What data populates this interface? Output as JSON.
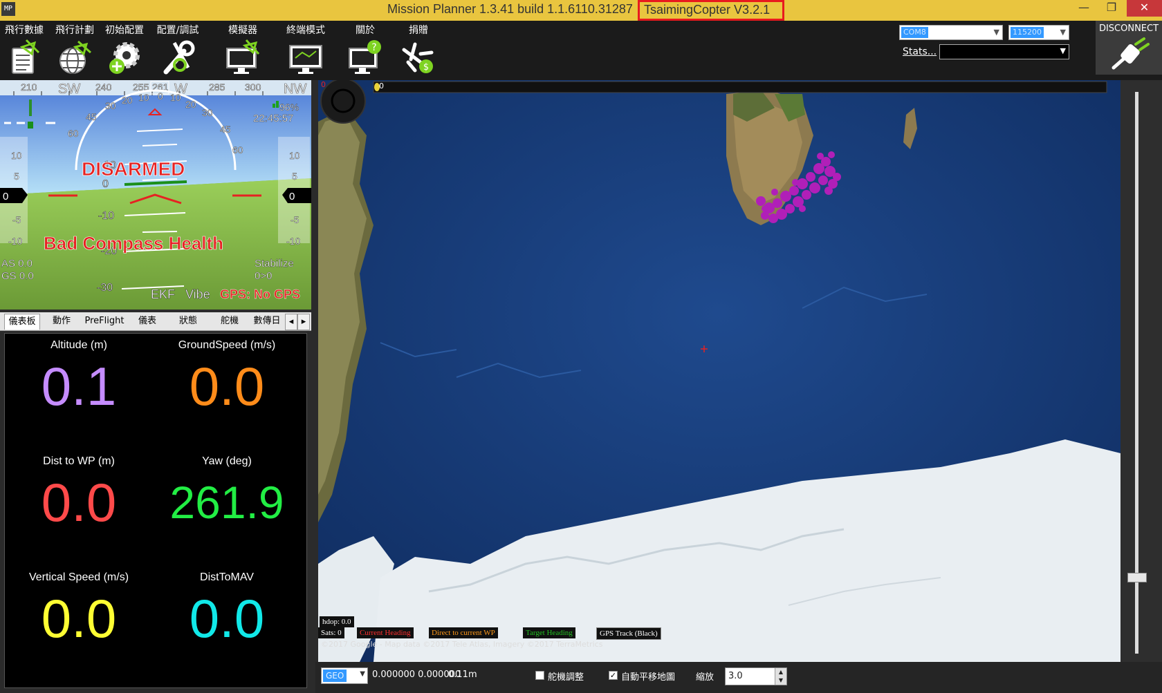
{
  "window": {
    "title_main": "Mission Planner 1.3.41 build 1.1.6110.31287",
    "title_firmware": "TsaimingCopter V3.2.1",
    "minimize": "—",
    "maximize": "❐",
    "close": "✕"
  },
  "menu": [
    {
      "label": "飛行數據",
      "icon": "flight-data-icon"
    },
    {
      "label": "飛行計劃",
      "icon": "flight-plan-icon"
    },
    {
      "label": "初始配置",
      "icon": "initial-setup-icon"
    },
    {
      "label": "配置/調試",
      "icon": "config-tuning-icon"
    },
    {
      "label": "模擬器",
      "icon": "simulation-icon"
    },
    {
      "label": "終端模式",
      "icon": "terminal-icon"
    },
    {
      "label": "關於",
      "icon": "help-icon"
    },
    {
      "label": "捐贈",
      "icon": "donate-icon"
    }
  ],
  "connection": {
    "port": "COM8",
    "baud": "115200",
    "stats_label": "Stats...",
    "connect_label": "DISCONNECT"
  },
  "hud": {
    "heading_ticks": [
      "210",
      "SW",
      "240",
      "255",
      "261",
      "W",
      "285",
      "300",
      "NW"
    ],
    "status": "DISARMED",
    "warning": "Bad Compass Health",
    "battery": "96%",
    "time": "22:45:57",
    "airspeed": "AS 0.0",
    "groundspeed": "GS 0.0",
    "mode": "Stabilize",
    "mode_sub": "0>0",
    "ekf": "EKF",
    "vibe": "Vibe",
    "gps": "GPS: No GPS",
    "pitch_labels": [
      "10",
      "0",
      "-10",
      "-20",
      "-30"
    ],
    "roll_labels": [
      "60",
      "45",
      "30",
      "20",
      "10",
      "0",
      "10",
      "20",
      "30",
      "45",
      "60"
    ],
    "speed_scale": [
      "10",
      "5",
      "0",
      "-5",
      "-10"
    ],
    "alt_scale": [
      "10",
      "5",
      "0",
      "-5",
      "-10"
    ],
    "speed_value": "0",
    "alt_value": "0"
  },
  "tabs": [
    "儀表板",
    "動作",
    "PreFlight",
    "儀表",
    "狀態",
    "舵機",
    "數傳日"
  ],
  "quick": [
    {
      "label": "Altitude (m)",
      "value": "0.1",
      "color": "#c58cff"
    },
    {
      "label": "GroundSpeed (m/s)",
      "value": "0.0",
      "color": "#ff8c1a"
    },
    {
      "label": "Dist to WP (m)",
      "value": "0.0",
      "color": "#ff4a4a"
    },
    {
      "label": "Yaw (deg)",
      "value": "261.9",
      "color": "#22ee44"
    },
    {
      "label": "Vertical Speed (m/s)",
      "value": "0.0",
      "color": "#ffff33"
    },
    {
      "label": "DistToMAV",
      "value": "0.0",
      "color": "#11e9e9"
    }
  ],
  "map": {
    "progress_label": "0",
    "red_label": "0",
    "hdop": "hdop: 0.0",
    "sats": "Sats: 0",
    "legend_current": "Current Heading",
    "legend_direct": "Direct to current WP",
    "legend_target": "Target Heading",
    "legend_gps": "GPS Track (Black)",
    "copyright": "©2017 Google - Map data ©2017 Tele Atlas, Imagery ©2017 TerraMetrics"
  },
  "status_bar": {
    "coord_type": "GEO",
    "coords": "0.000000 0.000000",
    "distance": "0.11m",
    "chk1_label": "舵機調整",
    "chk1_checked": false,
    "chk2_label": "自動平移地圖",
    "chk2_checked": true,
    "zoom_label": "縮放",
    "zoom_value": "3.0"
  },
  "colors": {
    "titlebar": "#e9c53f",
    "highlight_box": "#e8191e",
    "toolbar": "#1b1b1b",
    "hud_sky": "#8ec7f2",
    "hud_ground": "#87b64a",
    "hud_red": "#e62222"
  }
}
